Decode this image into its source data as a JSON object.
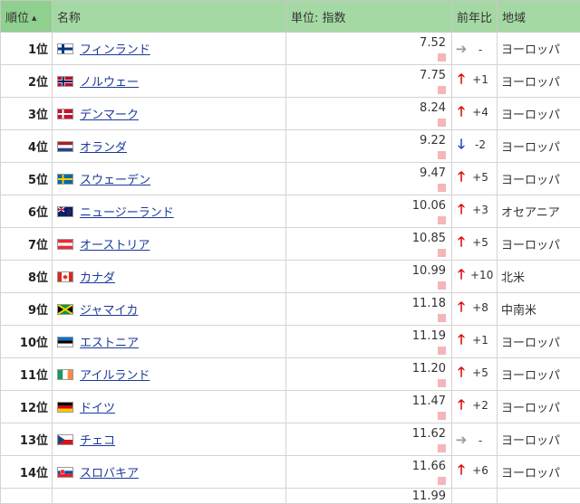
{
  "headers": {
    "rank": "順位",
    "name": "名称",
    "value": "単位: 指数",
    "change": "前年比",
    "region": "地域"
  },
  "rows": [
    {
      "rank": "1位",
      "name": "フィンランド",
      "flag": "finland",
      "value": "7.52",
      "dir": "flat",
      "arrow": "➔",
      "delta": "-",
      "region": "ヨーロッパ"
    },
    {
      "rank": "2位",
      "name": "ノルウェー",
      "flag": "norway",
      "value": "7.75",
      "dir": "up",
      "arrow": "🡑",
      "delta": "+1",
      "region": "ヨーロッパ"
    },
    {
      "rank": "3位",
      "name": "デンマーク",
      "flag": "denmark",
      "value": "8.24",
      "dir": "up",
      "arrow": "🡑",
      "delta": "+4",
      "region": "ヨーロッパ"
    },
    {
      "rank": "4位",
      "name": "オランダ",
      "flag": "netherlands",
      "value": "9.22",
      "dir": "down",
      "arrow": "🡓",
      "delta": "-2",
      "region": "ヨーロッパ"
    },
    {
      "rank": "5位",
      "name": "スウェーデン",
      "flag": "sweden",
      "value": "9.47",
      "dir": "up",
      "arrow": "🡑",
      "delta": "+5",
      "region": "ヨーロッパ"
    },
    {
      "rank": "6位",
      "name": "ニュージーランド",
      "flag": "newzealand",
      "value": "10.06",
      "dir": "up",
      "arrow": "🡑",
      "delta": "+3",
      "region": "オセアニア"
    },
    {
      "rank": "7位",
      "name": "オーストリア",
      "flag": "austria",
      "value": "10.85",
      "dir": "up",
      "arrow": "🡑",
      "delta": "+5",
      "region": "ヨーロッパ"
    },
    {
      "rank": "8位",
      "name": "カナダ",
      "flag": "canada",
      "value": "10.99",
      "dir": "up",
      "arrow": "🡑",
      "delta": "+10",
      "region": "北米"
    },
    {
      "rank": "9位",
      "name": "ジャマイカ",
      "flag": "jamaica",
      "value": "11.18",
      "dir": "up",
      "arrow": "🡑",
      "delta": "+8",
      "region": "中南米"
    },
    {
      "rank": "10位",
      "name": "エストニア",
      "flag": "estonia",
      "value": "11.19",
      "dir": "up",
      "arrow": "🡑",
      "delta": "+1",
      "region": "ヨーロッパ"
    },
    {
      "rank": "11位",
      "name": "アイルランド",
      "flag": "ireland",
      "value": "11.20",
      "dir": "up",
      "arrow": "🡑",
      "delta": "+5",
      "region": "ヨーロッパ"
    },
    {
      "rank": "12位",
      "name": "ドイツ",
      "flag": "germany",
      "value": "11.47",
      "dir": "up",
      "arrow": "🡑",
      "delta": "+2",
      "region": "ヨーロッパ"
    },
    {
      "rank": "13位",
      "name": "チェコ",
      "flag": "czech",
      "value": "11.62",
      "dir": "flat",
      "arrow": "➔",
      "delta": "-",
      "region": "ヨーロッパ"
    },
    {
      "rank": "14位",
      "name": "スロバキア",
      "flag": "slovakia",
      "value": "11.66",
      "dir": "up",
      "arrow": "🡑",
      "delta": "+6",
      "region": "ヨーロッパ"
    }
  ],
  "partial_row_value": "11.99"
}
